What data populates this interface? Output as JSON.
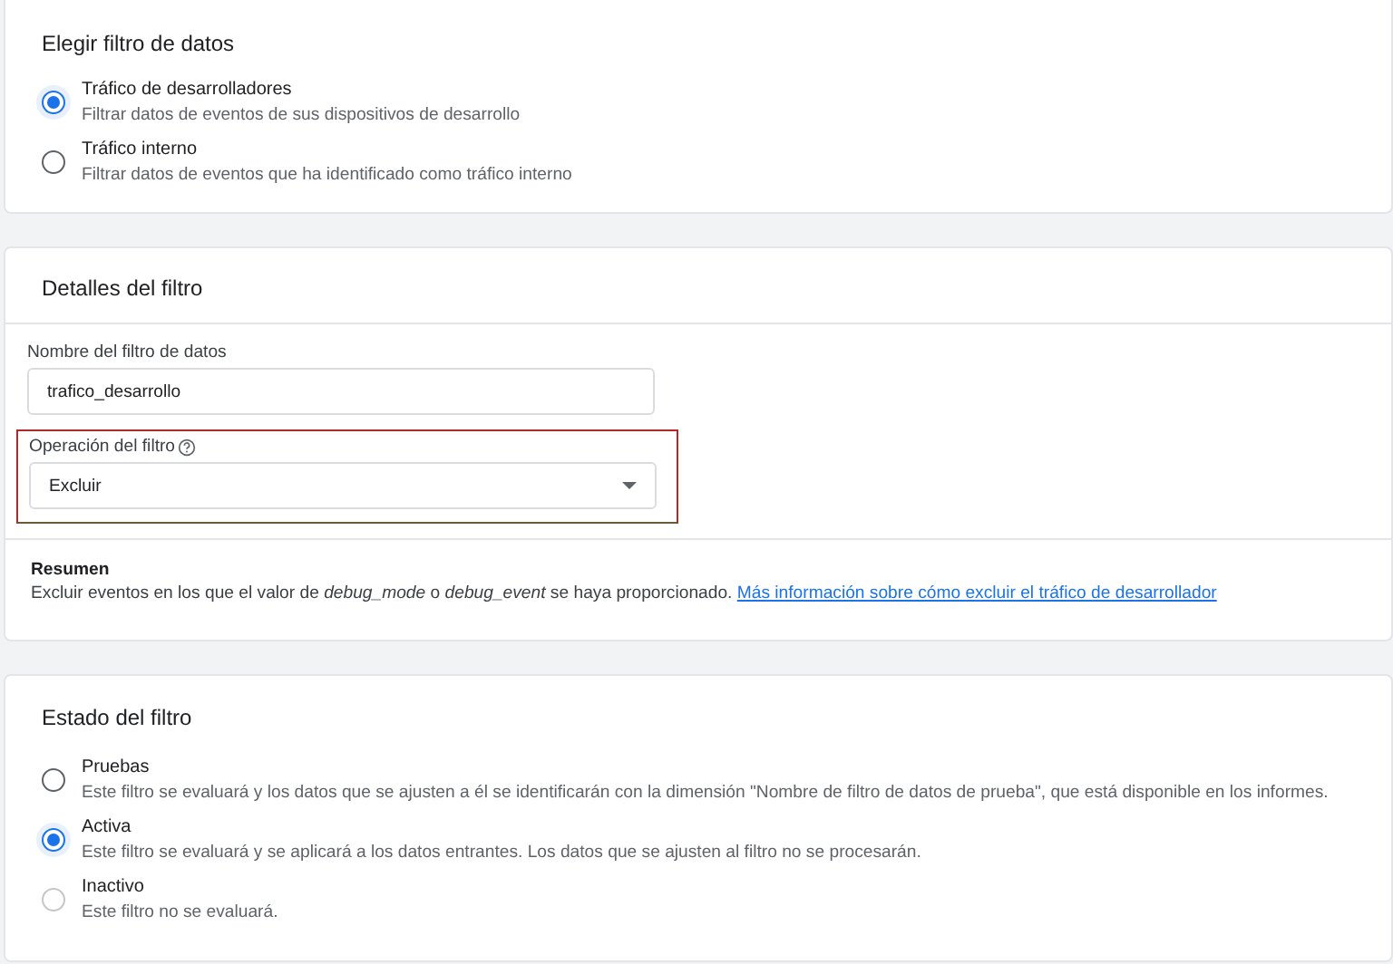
{
  "filter_type": {
    "title": "Elegir filtro de datos",
    "options": [
      {
        "label": "Tráfico de desarrolladores",
        "description": "Filtrar datos de eventos de sus dispositivos de desarrollo",
        "selected": true,
        "disabled": false
      },
      {
        "label": "Tráfico interno",
        "description": "Filtrar datos de eventos que ha identificado como tráfico interno",
        "selected": false,
        "disabled": false
      }
    ]
  },
  "details": {
    "title": "Detalles del filtro",
    "name_field": {
      "label": "Nombre del filtro de datos",
      "value": "trafico_desarrollo"
    },
    "operation_field": {
      "label": "Operación del filtro",
      "value": "Excluir",
      "highlighted": true
    },
    "summary": {
      "title": "Resumen",
      "text": "Excluir eventos en los que el valor de *debug_mode* o *debug_event* se haya proporcionado.",
      "link": "Más información sobre cómo excluir el tráfico de desarrollador"
    }
  },
  "filter_state": {
    "title": "Estado del filtro",
    "options": [
      {
        "label": "Pruebas",
        "description": "Este filtro se evaluará y los datos que se ajusten a él se identificarán con la dimensión \"Nombre de filtro de datos de prueba\", que está disponible en los informes.",
        "selected": false,
        "disabled": false
      },
      {
        "label": "Activa",
        "description": "Este filtro se evaluará y se aplicará a los datos entrantes. Los datos que se ajusten al filtro no se procesarán.",
        "selected": true,
        "disabled": false
      },
      {
        "label": "Inactivo",
        "description": "Este filtro no se evaluará.",
        "selected": false,
        "disabled": true
      }
    ]
  }
}
